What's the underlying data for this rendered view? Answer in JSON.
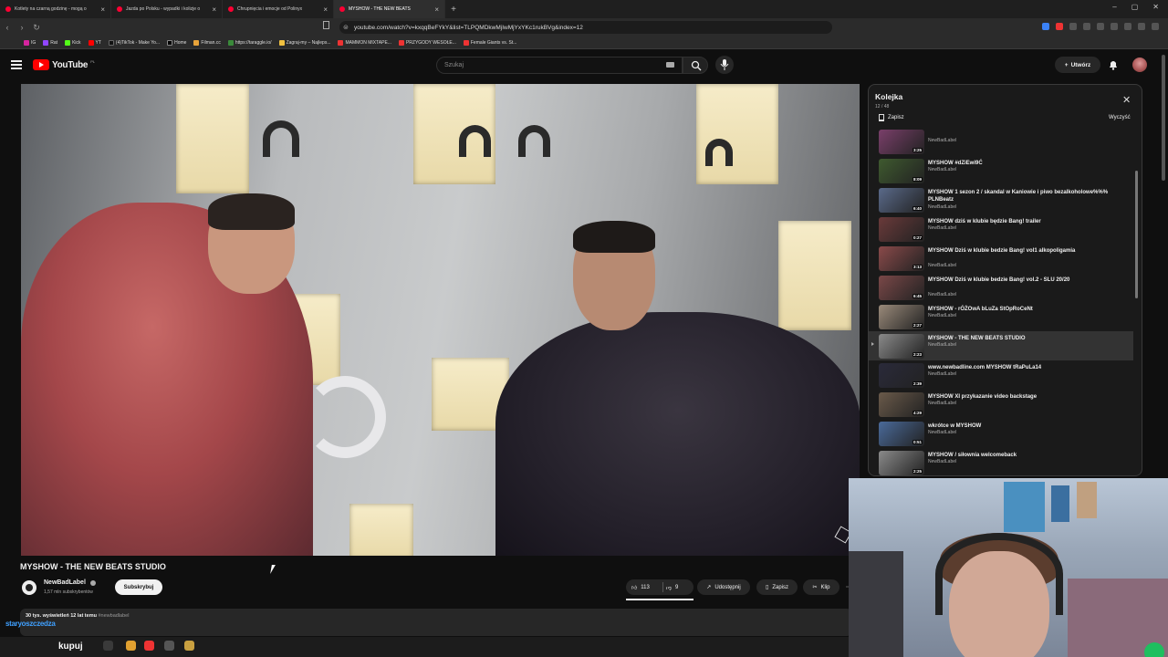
{
  "browser": {
    "tabs": [
      {
        "title": "Kotlety na czarną godzinę - mogą o"
      },
      {
        "title": "Jazda po Polsku - wypadki i kolizje o"
      },
      {
        "title": "Chrupnięcia i emocje od Polinyx"
      },
      {
        "title": "MYSHOW - THE NEW BEATS",
        "active": true
      }
    ],
    "url": "youtube.com/watch?v=kxqqBeFYkY&list=TLPQMDkwMjIwMjYxYKc1rukBVg&index=12",
    "bookmarks": [
      "IG",
      "Rat",
      "Kick",
      "YT",
      "(4)TikTok - Make Yo...",
      "Home",
      "Filman.cc",
      "https://taraggle.io/",
      "Zagraj-my – Najleps...",
      "MAMMON MIXTAPE...",
      "PRZYGODY WESOŁE...",
      "Female Giants vs. St..."
    ]
  },
  "youtube": {
    "logo_text": "YouTube",
    "logo_region": "PL",
    "search_placeholder": "Szukaj",
    "create_label": "Utwórz"
  },
  "video": {
    "title": "MYSHOW - THE NEW BEATS STUDIO",
    "channel": "NewBadLabel",
    "subscribers": "1,57 mln subskrybentów",
    "subscribe_label": "Subskrybuj",
    "likes": "113",
    "dislikes": "9",
    "share_label": "Udostępnij",
    "save_label": "Zapisz",
    "clip_label": "Klip",
    "views_date": "30 tys. wyświetleń  12 lat temu",
    "hashtag": "#newbadlabel"
  },
  "playlist": {
    "title": "Kolejka",
    "position": "12 / 48",
    "save_label": "Zapisz",
    "clear_label": "Wyczyść",
    "items": [
      {
        "title": "",
        "channel": "NewBadLabel",
        "duration": "3:25",
        "thumb": "#7a3f6a"
      },
      {
        "title": "MYSHOW #dZiEwi9Ć",
        "channel": "NewBadLabel",
        "duration": "8:09",
        "thumb": "#3f5a2f"
      },
      {
        "title": "MYSHOW 1 sezon 2 / skandal w Kaniowie i piwo bezalkoholowe%%% PLNBeatz",
        "channel": "NewBadLabel",
        "duration": "6:40",
        "thumb": "#5a6a8a"
      },
      {
        "title": "MYSHOW dziś w klubie będzie Bang! trailer",
        "channel": "NewBadLabel",
        "duration": "0:27",
        "thumb": "#6a3a3a"
      },
      {
        "title": "MYSHOW Dziś w klubie bedzie Bang! vol1 alkopoligamia",
        "channel": "NewBadLabel",
        "duration": "3:13",
        "thumb": "#8a4a4a"
      },
      {
        "title": "MYSHOW Dziś w klubie bedzie Bang! vol.2 - SLU 20/20",
        "channel": "NewBadLabel",
        "duration": "6:45",
        "thumb": "#7a4848"
      },
      {
        "title": "MYSHOW - rÓŻOwA bLuZa StOpRoCeNt",
        "channel": "NewBadLabel",
        "duration": "2:27",
        "thumb": "#9a8a7a"
      },
      {
        "title": "MYSHOW - THE NEW BEATS STUDIO",
        "channel": "NewBadLabel",
        "duration": "2:23",
        "thumb": "#8a8a8a",
        "current": true
      },
      {
        "title": "www.newbadline.com MYSHOW tRaPuLa14",
        "channel": "NewBadLabel",
        "duration": "2:39",
        "thumb": "#2a2a3a"
      },
      {
        "title": "MYSHOW XI przykazanie video backstage",
        "channel": "NewBadLabel",
        "duration": "4:29",
        "thumb": "#6a5a4a"
      },
      {
        "title": "wkrótce w MYSHOW",
        "channel": "NewBadLabel",
        "duration": "0:51",
        "thumb": "#4a6a9a"
      },
      {
        "title": "MYSHOW / siłownia welcomeback",
        "channel": "NewBadLabel",
        "duration": "2:25",
        "thumb": "#8a8a8a"
      }
    ]
  },
  "overlay": {
    "stream_text": "staryoszczedza",
    "kupuj": "kupuj"
  },
  "colors": {
    "youtube_red": "#ff0000",
    "background": "#0f0f0f"
  }
}
